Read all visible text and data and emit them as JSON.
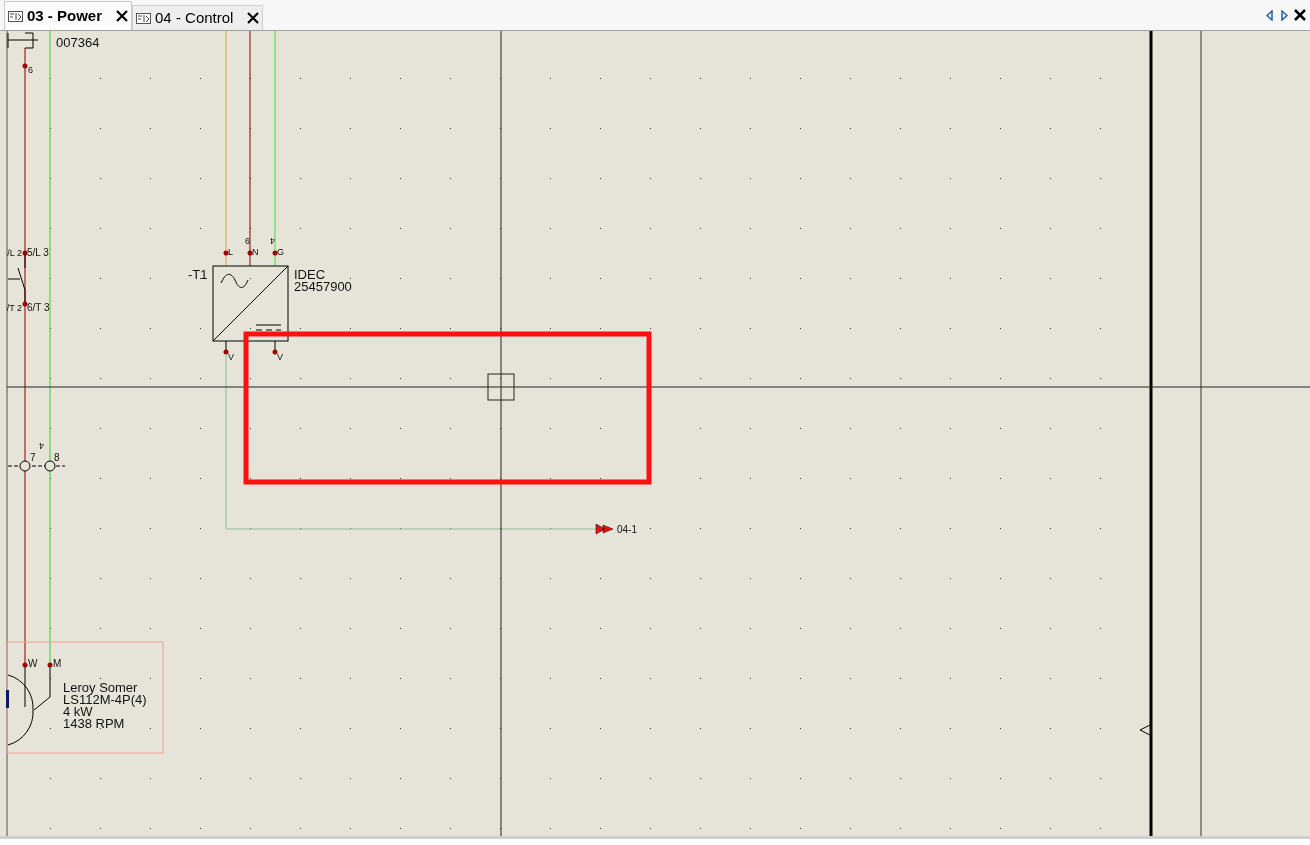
{
  "tabs": [
    {
      "label": "03 - Power",
      "selected": true
    },
    {
      "label": "04 - Control",
      "selected": false
    }
  ],
  "schematic": {
    "contactor": {
      "part": "007364",
      "terminal": "6"
    },
    "switch": {
      "terminals_top": [
        "/L 2",
        "5/L 3"
      ],
      "terminals_bottom": [
        "/T 2",
        "6/T 3"
      ]
    },
    "terminal_block": {
      "terminals": [
        "7",
        "8"
      ],
      "wire_number": "4"
    },
    "power_supply": {
      "tag": "-T1",
      "maker": "IDEC",
      "part": "25457900",
      "inputs": [
        "L",
        "N",
        "G"
      ],
      "input_wires": [
        "9",
        "4"
      ],
      "outputs": [
        "V",
        "V"
      ]
    },
    "off_page_reference": "04-1",
    "motor": {
      "terminals": [
        "W",
        "M"
      ],
      "lines": [
        "Leroy Somer",
        "LS112M-4P(4)",
        "4 kW",
        "1438 RPM"
      ]
    }
  }
}
